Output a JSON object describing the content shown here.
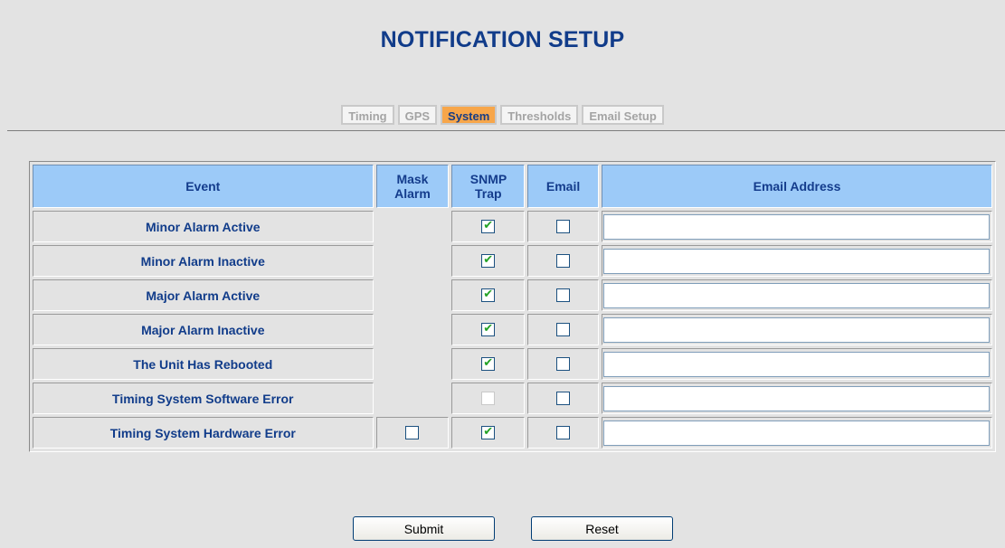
{
  "page": {
    "title": "NOTIFICATION SETUP"
  },
  "tabs": [
    {
      "label": "Timing",
      "active": false
    },
    {
      "label": "GPS",
      "active": false
    },
    {
      "label": "System",
      "active": true
    },
    {
      "label": "Thresholds",
      "active": false
    },
    {
      "label": "Email Setup",
      "active": false
    }
  ],
  "table": {
    "headers": {
      "event": "Event",
      "mask_alarm": "Mask Alarm",
      "snmp_trap": "SNMP Trap",
      "email": "Email",
      "email_address": "Email Address"
    },
    "rows": [
      {
        "event": "Minor Alarm Active",
        "mask_alarm": null,
        "snmp_trap": "checked",
        "email": "unchecked",
        "email_address": ""
      },
      {
        "event": "Minor Alarm Inactive",
        "mask_alarm": null,
        "snmp_trap": "checked",
        "email": "unchecked",
        "email_address": ""
      },
      {
        "event": "Major Alarm Active",
        "mask_alarm": null,
        "snmp_trap": "checked",
        "email": "unchecked",
        "email_address": ""
      },
      {
        "event": "Major Alarm Inactive",
        "mask_alarm": null,
        "snmp_trap": "checked",
        "email": "unchecked",
        "email_address": ""
      },
      {
        "event": "The Unit Has Rebooted",
        "mask_alarm": null,
        "snmp_trap": "checked",
        "email": "unchecked",
        "email_address": ""
      },
      {
        "event": "Timing System Software Error",
        "mask_alarm": null,
        "snmp_trap": "disabled",
        "email": "unchecked",
        "email_address": ""
      },
      {
        "event": "Timing System Hardware Error",
        "mask_alarm": "unchecked",
        "snmp_trap": "checked",
        "email": "unchecked",
        "email_address": ""
      }
    ]
  },
  "buttons": {
    "submit": "Submit",
    "reset": "Reset"
  },
  "colors": {
    "title": "#113c8a",
    "header_bg": "#9ccaf8",
    "active_tab": "#f7a64a",
    "page_bg": "#e3e3e3",
    "check": "#23a125"
  },
  "icons": {
    "checked": "checkmark-icon"
  }
}
